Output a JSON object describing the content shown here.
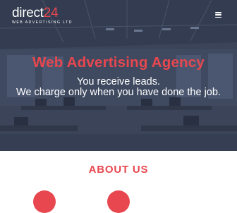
{
  "brand": {
    "name_main": "direct",
    "name_accent": "24",
    "tagline": "WEB ADVERTISING LTD"
  },
  "hero": {
    "title": "Web Advertising Agency",
    "line1": "You receive leads.",
    "line2": "We charge only when you have done the job."
  },
  "about": {
    "heading": "ABOUT US"
  },
  "colors": {
    "accent": "#e8474f",
    "hero_overlay": "#3a4458"
  },
  "icons": {
    "menu": "hamburger-menu-icon"
  }
}
